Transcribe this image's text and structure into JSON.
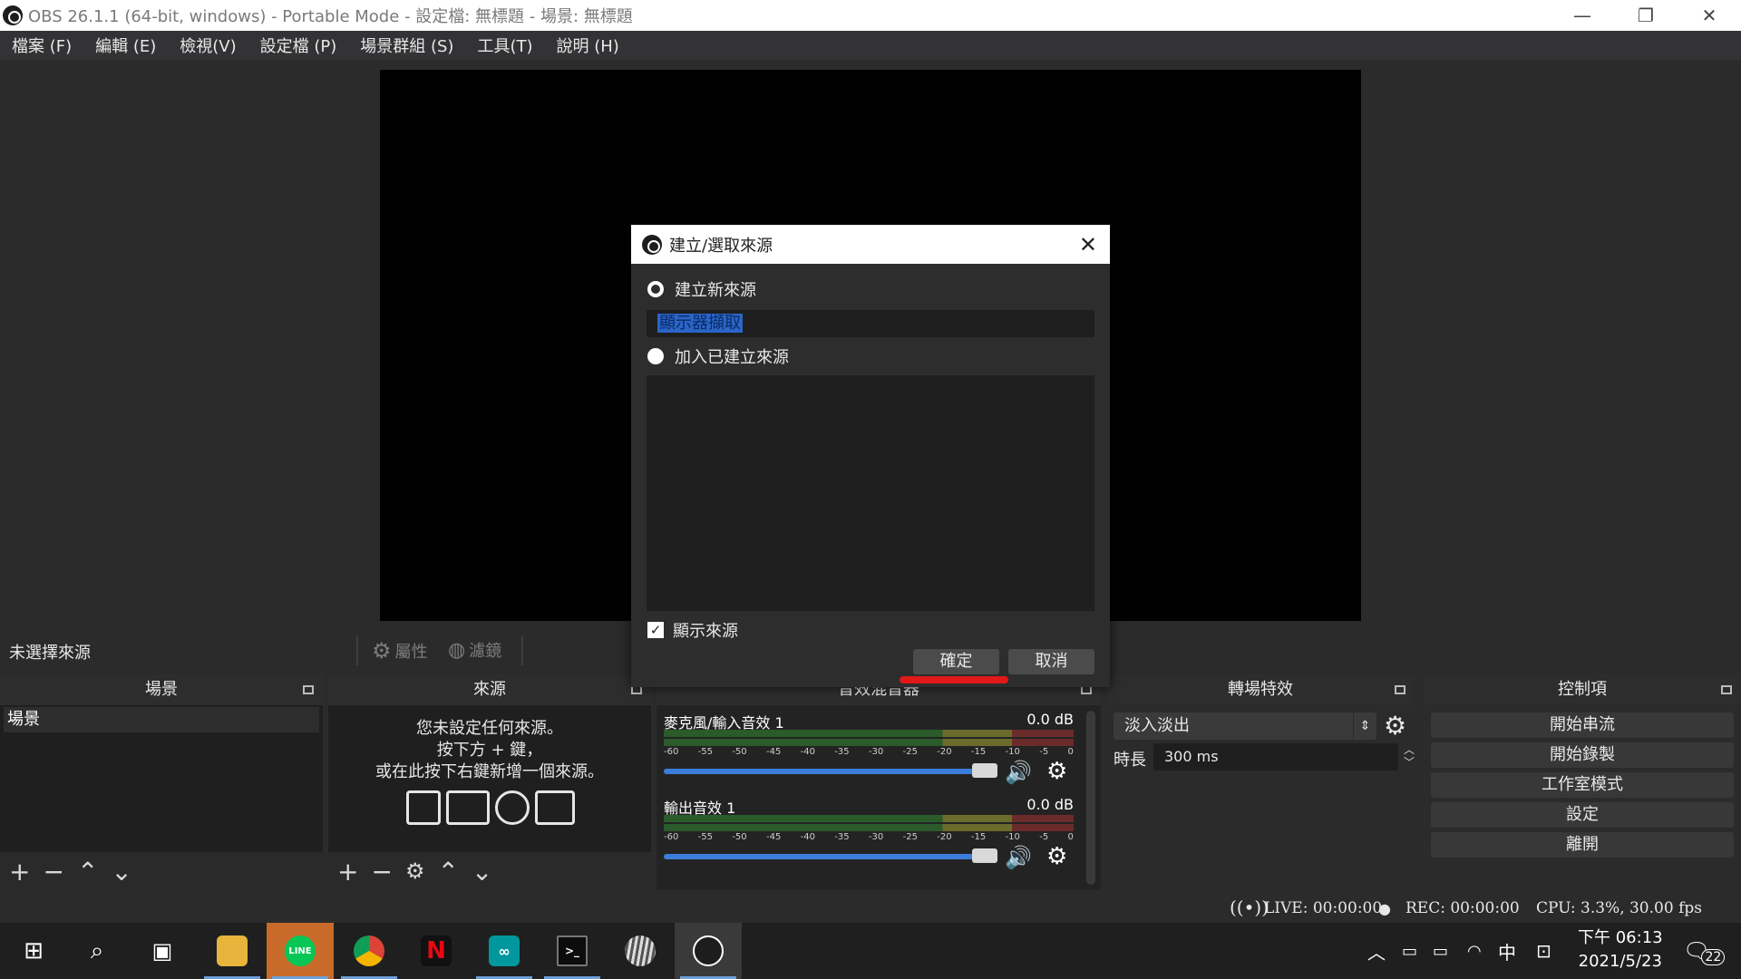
{
  "window": {
    "title": "OBS 26.1.1 (64-bit, windows) - Portable Mode - 設定檔: 無標題 - 場景: 無標題",
    "minimize": "—",
    "restore": "❐",
    "close": "✕"
  },
  "menu": [
    "檔案 (F)",
    "編輯 (E)",
    "檢視(V)",
    "設定檔 (P)",
    "場景群組 (S)",
    "工具(T)",
    "說明 (H)"
  ],
  "source_toolbar": {
    "no_source": "未選擇來源",
    "properties": "屬性",
    "filters": "濾鏡"
  },
  "docks": {
    "scenes": {
      "title": "場景",
      "items": [
        "場景"
      ]
    },
    "sources": {
      "title": "來源",
      "hint_lines": [
        "您未設定任何來源。",
        "按下方 + 鍵，",
        "或在此按下右鍵新增一個來源。"
      ]
    },
    "mixer": {
      "title": "音效混音器",
      "tracks": [
        {
          "name": "麥克風/輸入音效 1",
          "db": "0.0 dB",
          "volume": 1.0
        },
        {
          "name": "輸出音效 1",
          "db": "0.0 dB",
          "volume": 1.0
        }
      ],
      "scale": [
        "-60",
        "-55",
        "-50",
        "-45",
        "-40",
        "-35",
        "-30",
        "-25",
        "-20",
        "-15",
        "-10",
        "-5",
        "0"
      ]
    },
    "transitions": {
      "title": "轉場特效",
      "selected": "淡入淡出",
      "duration_label": "時長",
      "duration_value": "300 ms"
    },
    "controls": {
      "title": "控制項",
      "buttons": [
        "開始串流",
        "開始錄製",
        "工作室模式",
        "設定",
        "離開"
      ]
    }
  },
  "status": {
    "live": "LIVE: 00:00:00",
    "rec": "REC: 00:00:00",
    "cpu": "CPU: 3.3%, 30.00 fps"
  },
  "dialog": {
    "title": "建立/選取來源",
    "create_new_label": "建立新來源",
    "new_source_name": "顯示器擷取",
    "add_existing_label": "加入已建立來源",
    "visible_label": "顯示來源",
    "ok": "確定",
    "cancel": "取消",
    "selected_option": "create_new",
    "visible_checked": true
  },
  "taskbar": {
    "apps": [
      "file-explorer",
      "line",
      "chrome",
      "netflix",
      "arduino",
      "terminal",
      "browser-globe",
      "obs"
    ],
    "line_label": "LINE",
    "netflix_label": "N",
    "ime": "中",
    "time": "下午 06:13",
    "date": "2021/5/23",
    "notifications": "22"
  },
  "colors": {
    "accent_blue": "#3c7dd9",
    "selection": "#2a65c7",
    "red_mark": "#e01818"
  }
}
